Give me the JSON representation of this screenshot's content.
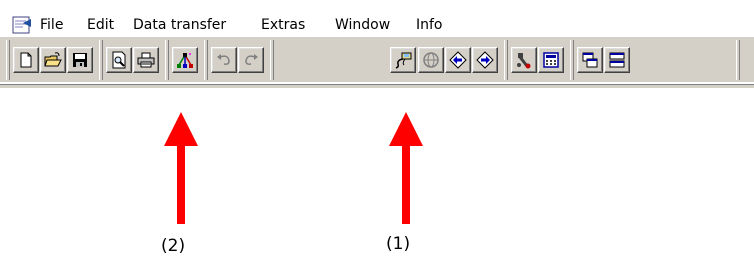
{
  "menu": {
    "items": [
      "File",
      "Edit",
      "Data transfer",
      "Extras",
      "Window",
      "Info"
    ]
  },
  "toolbar": {
    "buttons": [
      {
        "icon": "new-document-icon",
        "enabled": true
      },
      {
        "icon": "open-folder-icon",
        "enabled": true
      },
      {
        "icon": "save-disk-icon",
        "enabled": true
      },
      {
        "icon": "print-preview-icon",
        "enabled": true
      },
      {
        "icon": "printer-icon",
        "enabled": true
      },
      {
        "icon": "network-tree-icon",
        "enabled": true
      },
      {
        "icon": "undo-icon",
        "enabled": false
      },
      {
        "icon": "redo-icon",
        "enabled": false
      },
      {
        "icon": "connect-online-icon",
        "enabled": true
      },
      {
        "icon": "globe-online-icon",
        "enabled": false
      },
      {
        "icon": "upload-arrow-icon",
        "enabled": true
      },
      {
        "icon": "download-arrow-icon",
        "enabled": true
      },
      {
        "icon": "diagnostics-tool-icon",
        "enabled": true
      },
      {
        "icon": "calculator-icon",
        "enabled": true
      },
      {
        "icon": "cascade-windows-icon",
        "enabled": true
      },
      {
        "icon": "tile-windows-icon",
        "enabled": true
      }
    ]
  },
  "annotations": {
    "left_label": "(2)",
    "right_label": "(1)",
    "arrow_color": "#ff0000"
  },
  "colors": {
    "toolbar_bg": "#d4d0c8",
    "icon_blue": "#0000c0",
    "icon_red": "#c00000"
  }
}
